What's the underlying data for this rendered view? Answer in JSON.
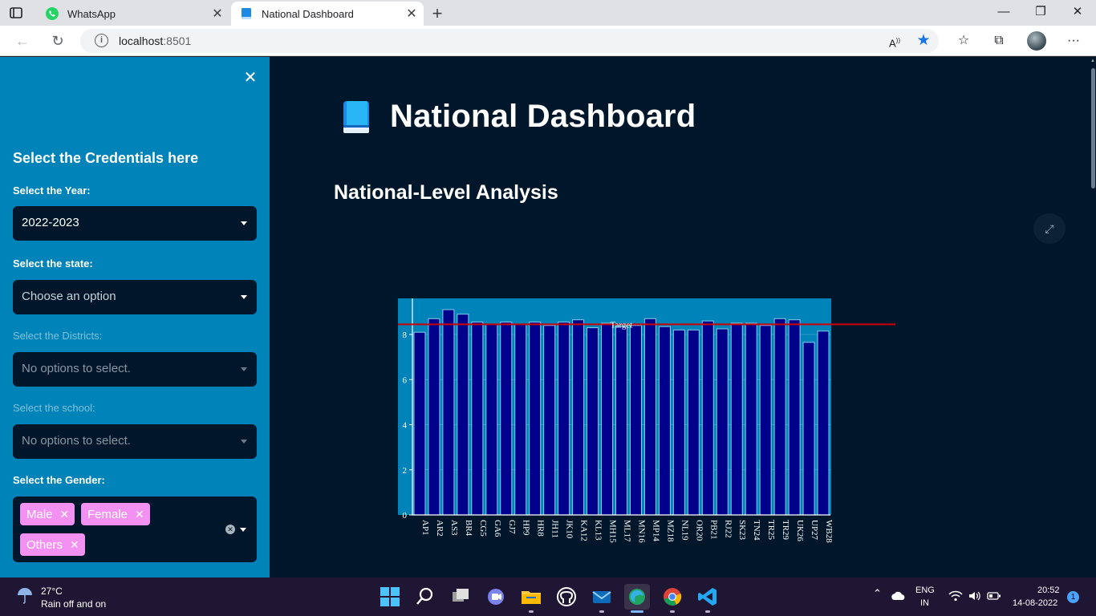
{
  "browser": {
    "tabs": [
      {
        "title": "WhatsApp",
        "active": false
      },
      {
        "title": "National Dashboard",
        "active": true
      }
    ],
    "new_tab": "+",
    "url_host": "localhost",
    "url_port": ":8501"
  },
  "sidebar": {
    "heading": "Select the Credentials here",
    "year_label": "Select the Year:",
    "year_value": "2022-2023",
    "state_label": "Select the state:",
    "state_placeholder": "Choose an option",
    "districts_label": "Select the Districts:",
    "districts_placeholder": "No options to select.",
    "school_label": "Select the school:",
    "school_placeholder": "No options to select.",
    "gender_label": "Select the Gender:",
    "gender_chips": [
      "Male",
      "Female",
      "Others"
    ]
  },
  "main": {
    "title": "National Dashboard",
    "subheading": "National-Level Analysis"
  },
  "chart_data": {
    "type": "bar",
    "categories": [
      "AP1",
      "AR2",
      "AS3",
      "BR4",
      "CG5",
      "GA6",
      "GJ7",
      "HP9",
      "HR8",
      "JH11",
      "JK10",
      "KA12",
      "KL13",
      "MH15",
      "ML17",
      "MN16",
      "MP14",
      "MZ18",
      "NL19",
      "OR20",
      "PB21",
      "RJ22",
      "SK23",
      "TN24",
      "TR25",
      "TR29",
      "UK26",
      "UP27",
      "WB28"
    ],
    "values": [
      8.1,
      8.7,
      9.1,
      8.9,
      8.55,
      8.45,
      8.55,
      8.45,
      8.55,
      8.4,
      8.55,
      8.65,
      8.3,
      8.5,
      8.35,
      8.4,
      8.7,
      8.35,
      8.2,
      8.2,
      8.6,
      8.25,
      8.5,
      8.5,
      8.4,
      8.7,
      8.65,
      7.65,
      8.15
    ],
    "target": 8.45,
    "target_label": "Target",
    "yticks": [
      0,
      2,
      4,
      6,
      8
    ],
    "ylim": [
      0,
      9.6
    ],
    "colors": {
      "bar": "#00008b",
      "bar_edge": "#87ceeb",
      "plot_bg": "#0083b8",
      "target_line": "#cc0000"
    }
  },
  "taskbar": {
    "temperature": "27°C",
    "weather": "Rain off and on",
    "lang_1": "ENG",
    "lang_2": "IN",
    "time": "20:52",
    "date": "14-08-2022",
    "notifications": "1"
  }
}
